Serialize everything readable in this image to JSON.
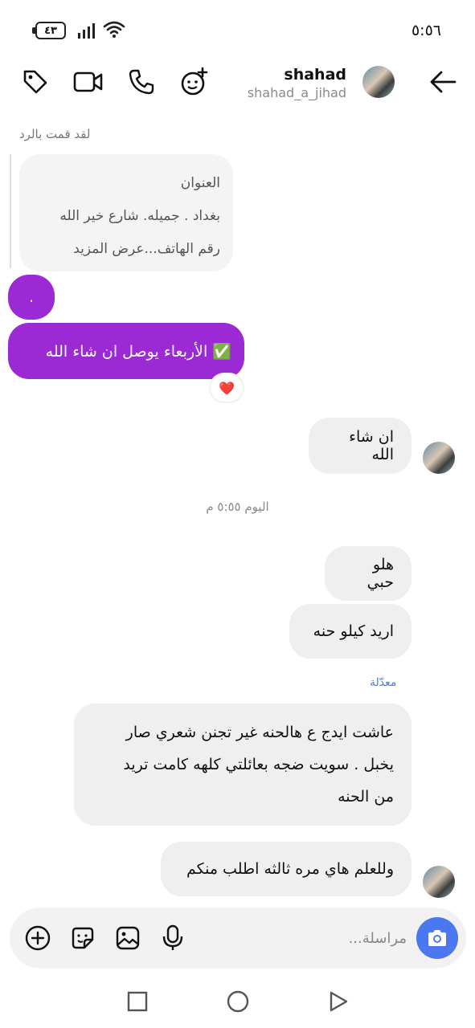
{
  "status_bar": {
    "battery": "٤٣",
    "time": "٥:٥٦"
  },
  "header": {
    "contact_name": "shahad",
    "contact_handle": "shahad_a_jihad"
  },
  "chat": {
    "reply_label": "لقد قمت بالرد",
    "quoted_lines": [
      "العنوان",
      "بغداد . جميله. شارع خير الله",
      "رقم الهاتف...عرض المزيد"
    ],
    "dot_message": ".",
    "wednesday_message": "✅ الأربعاء يوصل ان شاء الله",
    "reaction": "❤️",
    "reply_inshallah": "ان شاء الله",
    "timestamp": "اليوم ٥:٥٥ م",
    "msg_hello": "هلو حبي",
    "msg_want_henna": "اريد كيلو حنه",
    "edited_label": "معدّلة",
    "msg_long": [
      "عاشت ايدج ع هالحنه غير تجنن شعري صار",
      "يخبل . سويت ضجه بعائلتي كلهه كامت تريد",
      "من الحنه"
    ],
    "msg_third_time": "وللعلم هاي مره ثالثه اطلب منكم"
  },
  "composer": {
    "placeholder": "مراسلة..."
  },
  "colors": {
    "my_bubble": "#9b29d4",
    "their_bubble": "#efefef",
    "camera_button": "#4b78f0",
    "edited_label": "#4f7cd9"
  }
}
